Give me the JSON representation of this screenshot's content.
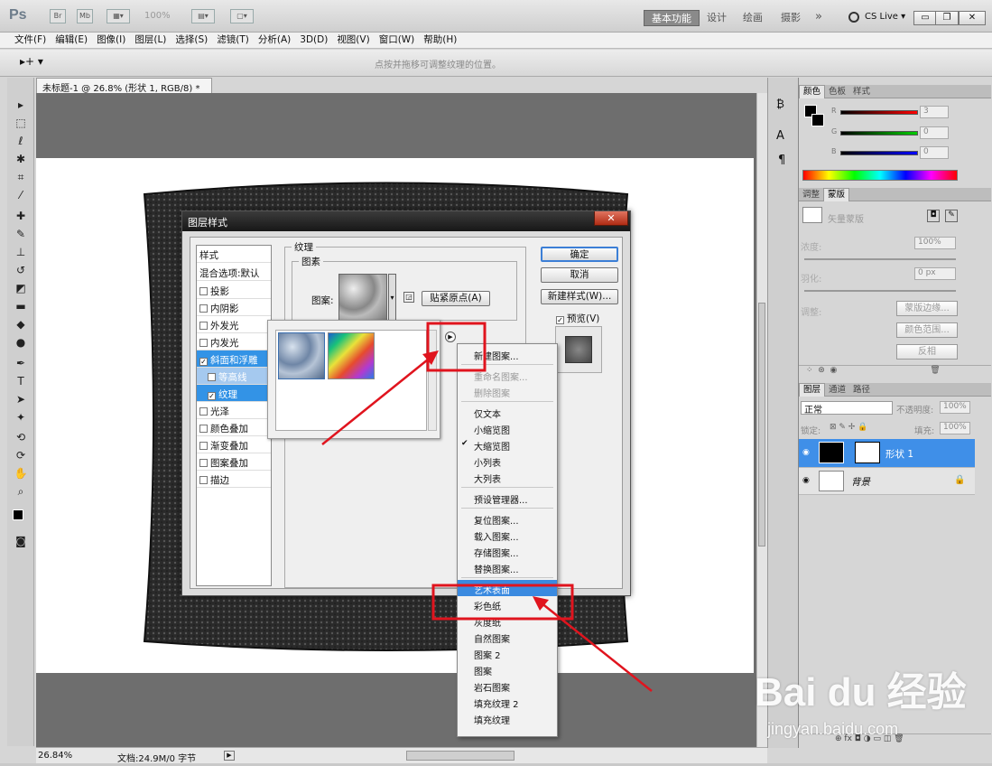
{
  "app": {
    "logo": "Ps",
    "zoom": "100%"
  },
  "workspace": {
    "active": "基本功能",
    "items": [
      "设计",
      "绘画",
      "摄影"
    ],
    "more": "»",
    "cs_live": "CS Live ▾"
  },
  "menu": [
    "文件(F)",
    "编辑(E)",
    "图像(I)",
    "图层(L)",
    "选择(S)",
    "滤镜(T)",
    "分析(A)",
    "3D(D)",
    "视图(V)",
    "窗口(W)",
    "帮助(H)"
  ],
  "options_hint": "点按并拖移可调整纹理的位置。",
  "document": {
    "tab": "未标题-1 @ 26.8% (形状 1, RGB/8) *",
    "zoom": "26.84%",
    "doc_size": "文档:24.9M/0 字节"
  },
  "dialog": {
    "title": "图层样式",
    "styles_header": "样式",
    "blend_default": "混合选项:默认",
    "styles": [
      {
        "label": "投影",
        "checked": false
      },
      {
        "label": "内阴影",
        "checked": false
      },
      {
        "label": "外发光",
        "checked": false
      },
      {
        "label": "内发光",
        "checked": false
      },
      {
        "label": "斜面和浮雕",
        "checked": true
      },
      {
        "label": "等高线",
        "checked": false
      },
      {
        "label": "纹理",
        "checked": true
      },
      {
        "label": "光泽",
        "checked": false
      },
      {
        "label": "颜色叠加",
        "checked": false
      },
      {
        "label": "渐变叠加",
        "checked": false
      },
      {
        "label": "图案叠加",
        "checked": false
      },
      {
        "label": "描边",
        "checked": false
      }
    ],
    "texture_group": "纹理",
    "elements_group": "图素",
    "pattern_label": "图案:",
    "snap_button": "贴紧原点(A)",
    "ok": "确定",
    "cancel": "取消",
    "new_style": "新建样式(W)...",
    "preview": "预览(V)"
  },
  "pattern_menu": {
    "items": [
      {
        "label": "新建图案...",
        "disabled": false,
        "checked": false
      },
      {
        "sep": true
      },
      {
        "label": "重命名图案...",
        "disabled": true,
        "checked": false
      },
      {
        "label": "删除图案",
        "disabled": true,
        "checked": false
      },
      {
        "sep": true
      },
      {
        "label": "仅文本",
        "disabled": false,
        "checked": false
      },
      {
        "label": "小缩览图",
        "disabled": false,
        "checked": false
      },
      {
        "label": "大缩览图",
        "disabled": false,
        "checked": true
      },
      {
        "label": "小列表",
        "disabled": false,
        "checked": false
      },
      {
        "label": "大列表",
        "disabled": false,
        "checked": false
      },
      {
        "sep": true
      },
      {
        "label": "预设管理器...",
        "disabled": false,
        "checked": false
      },
      {
        "sep": true
      },
      {
        "label": "复位图案...",
        "disabled": false,
        "checked": false
      },
      {
        "label": "载入图案...",
        "disabled": false,
        "checked": false
      },
      {
        "label": "存储图案...",
        "disabled": false,
        "checked": false
      },
      {
        "label": "替换图案...",
        "disabled": false,
        "checked": false
      },
      {
        "sep": true
      },
      {
        "label": "艺术表面",
        "disabled": false,
        "checked": false,
        "highlighted": true
      },
      {
        "label": "彩色纸",
        "disabled": false,
        "checked": false
      },
      {
        "label": "灰度纸",
        "disabled": false,
        "checked": false
      },
      {
        "label": "自然图案",
        "disabled": false,
        "checked": false
      },
      {
        "label": "图案 2",
        "disabled": false,
        "checked": false
      },
      {
        "label": "图案",
        "disabled": false,
        "checked": false
      },
      {
        "label": "岩石图案",
        "disabled": false,
        "checked": false
      },
      {
        "label": "填充纹理 2",
        "disabled": false,
        "checked": false
      },
      {
        "label": "填充纹理",
        "disabled": false,
        "checked": false
      }
    ]
  },
  "color_panel": {
    "tabs": [
      "颜色",
      "色板",
      "样式"
    ],
    "channels": [
      {
        "name": "R",
        "value": "3"
      },
      {
        "name": "G",
        "value": "0"
      },
      {
        "name": "B",
        "value": "0"
      }
    ]
  },
  "masks_panel": {
    "tabs": [
      "调整",
      "蒙版"
    ],
    "title": "矢量蒙版",
    "density_label": "浓度:",
    "density": "100%",
    "feather_label": "羽化:",
    "feather": "0 px",
    "adjust_label": "调整:",
    "btn_edge": "蒙版边缘...",
    "btn_range": "颜色范围...",
    "btn_invert": "反相"
  },
  "layers_panel": {
    "tabs": [
      "图层",
      "通道",
      "路径"
    ],
    "blend_mode": "正常",
    "opacity_label": "不透明度:",
    "opacity": "100%",
    "lock_label": "锁定:",
    "fill_label": "填充:",
    "fill": "100%",
    "layers": [
      {
        "name": "形状 1",
        "selected": true
      },
      {
        "name": "背景",
        "selected": false
      }
    ]
  },
  "watermark": {
    "main": "Bai du 经验",
    "sub": "jingyan.baidu.com"
  },
  "colors": {
    "highlight": "#3a8ae0",
    "annotation": "#e0141e",
    "selected_layer": "#3f8fe8"
  }
}
